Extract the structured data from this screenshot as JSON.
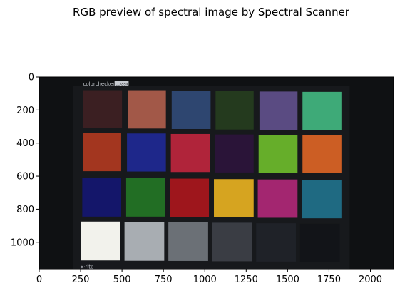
{
  "chart_data": {
    "type": "image",
    "title": "RGB preview of spectral image by Spectral Scanner",
    "xlabel": "",
    "ylabel": "",
    "xlim": [
      0,
      2140
    ],
    "ylim": [
      1165,
      0
    ],
    "x_ticks": [
      0,
      250,
      500,
      750,
      1000,
      1250,
      1500,
      1750,
      2000
    ],
    "y_ticks": [
      0,
      200,
      400,
      600,
      800,
      1000
    ],
    "target": {
      "brand_label": "colorchecker",
      "badge_label": "CLASSIC",
      "maker_label": "x·rite"
    },
    "patches": [
      {
        "x0": 265,
        "x1": 500,
        "y0": 80,
        "y1": 310,
        "color": "#3b1f22"
      },
      {
        "x0": 535,
        "x1": 765,
        "y0": 80,
        "y1": 312,
        "color": "#a25848"
      },
      {
        "x0": 800,
        "x1": 1035,
        "y0": 85,
        "y1": 315,
        "color": "#2e4670"
      },
      {
        "x0": 1065,
        "x1": 1295,
        "y0": 85,
        "y1": 318,
        "color": "#243a1e"
      },
      {
        "x0": 1330,
        "x1": 1560,
        "y0": 88,
        "y1": 320,
        "color": "#5a4b82"
      },
      {
        "x0": 1590,
        "x1": 1825,
        "y0": 90,
        "y1": 322,
        "color": "#3eaa78"
      },
      {
        "x0": 265,
        "x1": 495,
        "y0": 340,
        "y1": 570,
        "color": "#a3361f"
      },
      {
        "x0": 530,
        "x1": 765,
        "y0": 342,
        "y1": 572,
        "color": "#1e278a"
      },
      {
        "x0": 795,
        "x1": 1030,
        "y0": 345,
        "y1": 575,
        "color": "#b0243a"
      },
      {
        "x0": 1060,
        "x1": 1295,
        "y0": 348,
        "y1": 578,
        "color": "#2a1438"
      },
      {
        "x0": 1325,
        "x1": 1560,
        "y0": 350,
        "y1": 580,
        "color": "#66ae2a"
      },
      {
        "x0": 1590,
        "x1": 1825,
        "y0": 352,
        "y1": 582,
        "color": "#cc5e24"
      },
      {
        "x0": 260,
        "x1": 495,
        "y0": 610,
        "y1": 845,
        "color": "#14166a"
      },
      {
        "x0": 525,
        "x1": 760,
        "y0": 612,
        "y1": 845,
        "color": "#226e24"
      },
      {
        "x0": 790,
        "x1": 1025,
        "y0": 615,
        "y1": 848,
        "color": "#9e161c"
      },
      {
        "x0": 1055,
        "x1": 1295,
        "y0": 618,
        "y1": 850,
        "color": "#d6a420"
      },
      {
        "x0": 1320,
        "x1": 1560,
        "y0": 620,
        "y1": 852,
        "color": "#a32670"
      },
      {
        "x0": 1585,
        "x1": 1825,
        "y0": 622,
        "y1": 855,
        "color": "#1f6a82"
      },
      {
        "x0": 250,
        "x1": 490,
        "y0": 875,
        "y1": 1110,
        "color": "#f2f2ec"
      },
      {
        "x0": 515,
        "x1": 755,
        "y0": 878,
        "y1": 1112,
        "color": "#a8adb2"
      },
      {
        "x0": 780,
        "x1": 1020,
        "y0": 880,
        "y1": 1113,
        "color": "#6b7076"
      },
      {
        "x0": 1045,
        "x1": 1285,
        "y0": 882,
        "y1": 1115,
        "color": "#3a3d44"
      },
      {
        "x0": 1310,
        "x1": 1550,
        "y0": 885,
        "y1": 1117,
        "color": "#1f2228"
      },
      {
        "x0": 1575,
        "x1": 1815,
        "y0": 888,
        "y1": 1120,
        "color": "#121418"
      }
    ],
    "colors": {
      "background": "#0f1113",
      "board": "#17191c"
    }
  }
}
